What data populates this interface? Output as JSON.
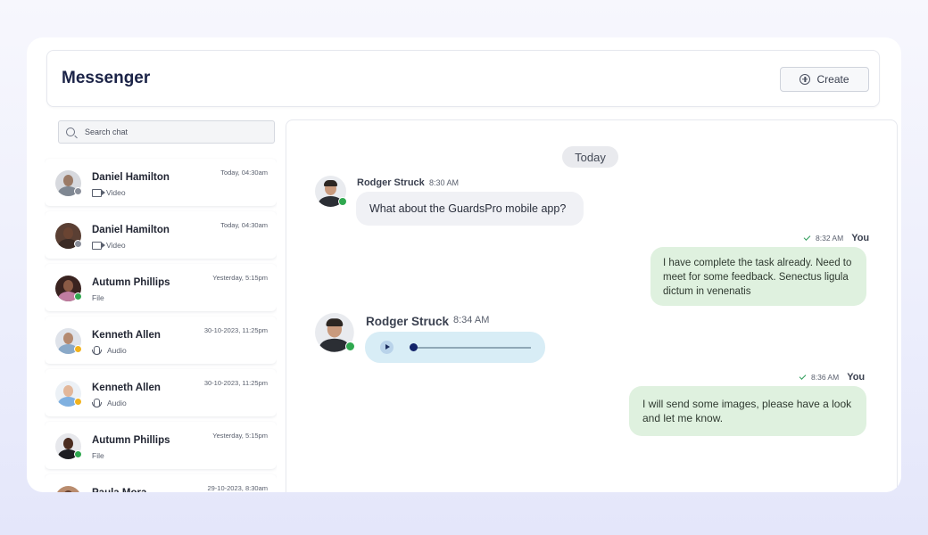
{
  "app": {
    "title": "Messenger",
    "create_label": "Create"
  },
  "search": {
    "placeholder": "Search chat"
  },
  "chats": [
    {
      "name": "Daniel Hamilton",
      "time": "Today, 04:30am",
      "type": "Video",
      "icon": "video-icon",
      "status": "#8a8f9a",
      "skin": "#9a7a66",
      "shirt": "#7f8792",
      "bg": "#d7d9de"
    },
    {
      "name": "Daniel Hamilton",
      "time": "Today, 04:30am",
      "type": "Video",
      "icon": "video-icon",
      "status": "#8a8f9a",
      "skin": "#6a4432",
      "shirt": "#3a2a24",
      "bg": "#5a3f33"
    },
    {
      "name": "Autumn Phillips",
      "time": "Yesterday, 5:15pm",
      "type": "File",
      "icon": "",
      "status": "#2fa84f",
      "skin": "#8b5a45",
      "shirt": "#c07ca0",
      "bg": "#3a2320"
    },
    {
      "name": "Kenneth Allen",
      "time": "30-10-2023, 11:25pm",
      "type": "Audio",
      "icon": "mic-icon",
      "status": "#f2b21c",
      "skin": "#b48a70",
      "shirt": "#8aa9c8",
      "bg": "#dfe3ea"
    },
    {
      "name": "Kenneth Allen",
      "time": "30-10-2023, 11:25pm",
      "type": "Audio",
      "icon": "mic-icon",
      "status": "#f2b21c",
      "skin": "#e2b79a",
      "shirt": "#7fb0e0",
      "bg": "#ecf1f6"
    },
    {
      "name": "Autumn Phillips",
      "time": "Yesterday, 5:15pm",
      "type": "File",
      "icon": "",
      "status": "#2fa84f",
      "skin": "#4a2c20",
      "shirt": "#1e1e22",
      "bg": "#e7e8ec"
    },
    {
      "name": "Paula Mora",
      "time": "29-10-2023, 8:30am",
      "type": "",
      "icon": "",
      "status": "#2fa84f",
      "skin": "#6a4432",
      "shirt": "#3a2a24",
      "bg": "#b98c6e"
    }
  ],
  "conversation": {
    "date_label": "Today",
    "messages": [
      {
        "sender": "Rodger Struck",
        "time": "8:30 AM",
        "text": "What about the GuardsPro mobile app?"
      },
      {
        "sender": "You",
        "time": "8:32 AM",
        "text": "I have complete the task already. Need to meet for some feedback. Senectus ligula dictum in venenatis"
      },
      {
        "sender": "Rodger Struck",
        "time": "8:34 AM",
        "type": "audio",
        "progress": 0.03
      },
      {
        "sender": "You",
        "time": "8:36 AM",
        "text": "I will send some images, please have a look and let me know."
      }
    ]
  },
  "colors": {
    "online": "#2fa84f",
    "away": "#f2b21c",
    "offline": "#8a8f9a",
    "outgoing_bubble": "#dff1df",
    "audio_bubble": "#d8edf6",
    "brand_title": "#1b2347"
  }
}
